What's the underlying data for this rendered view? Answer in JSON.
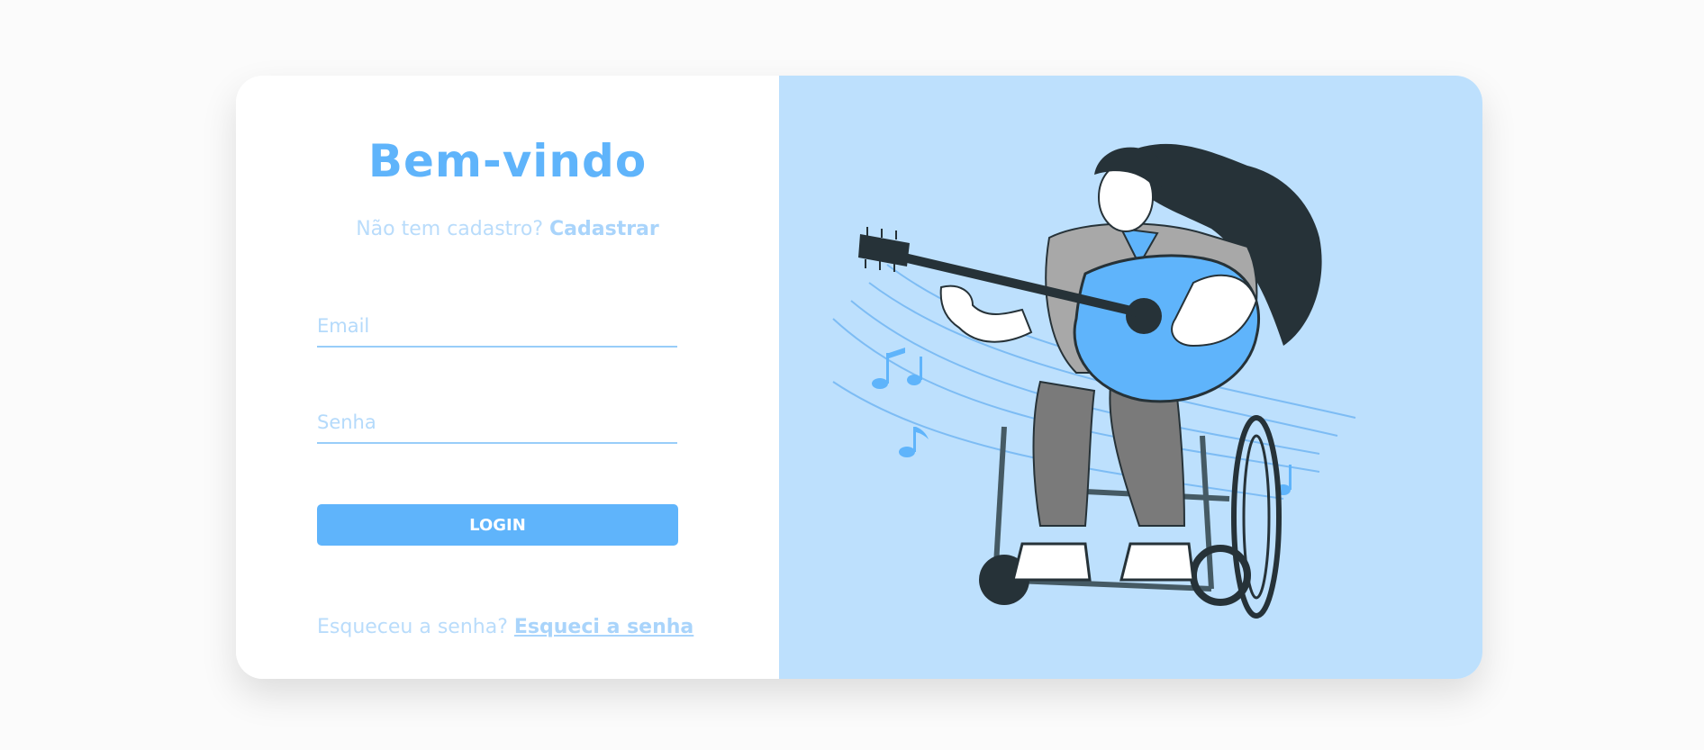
{
  "login": {
    "title": "Bem-vindo",
    "signup_prompt": "Não tem cadastro?",
    "signup_link": "Cadastrar",
    "email_placeholder": "Email",
    "password_placeholder": "Senha",
    "login_button": "LOGIN",
    "forgot_prompt": "Esqueceu a senha?",
    "forgot_link": "Esqueci a senha"
  },
  "colors": {
    "accent": "#5fb4fb",
    "panel": "#bde0fd",
    "muted_text": "#b9dcfb"
  },
  "illustration": {
    "icon": "woman-wheelchair-guitar-illustration"
  }
}
